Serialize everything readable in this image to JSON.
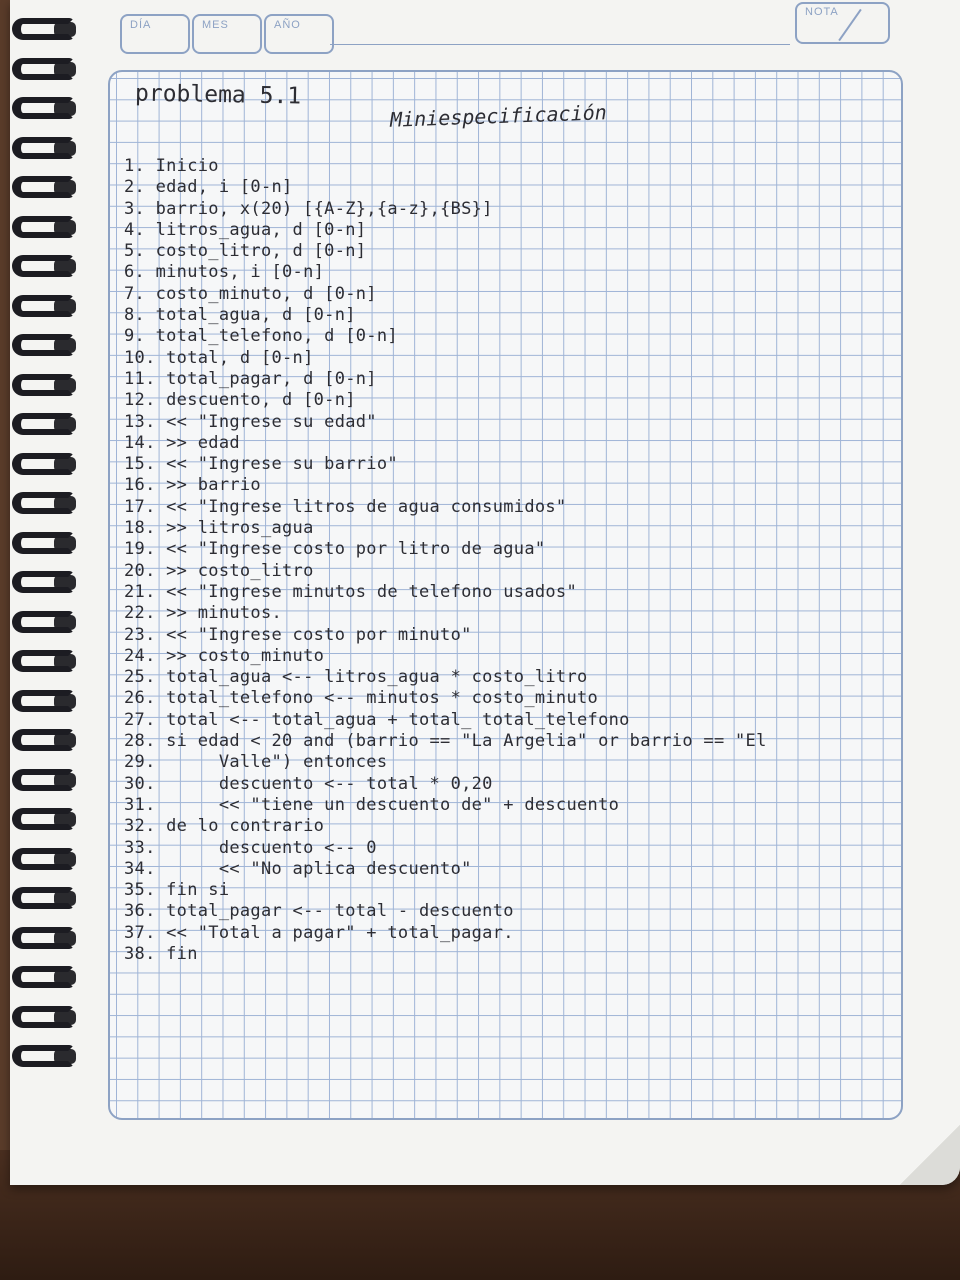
{
  "header": {
    "dia_label": "DÍA",
    "mes_label": "MES",
    "ano_label": "AÑO",
    "nota_label": "NOTA"
  },
  "heading": {
    "title": "problema 5.1",
    "subtitle": "Miniespecificación"
  },
  "lines": [
    "1. Inicio",
    "2. edad, i [0-n]",
    "3. barrio, x(20) [{A-Z},{a-z},{BS}]",
    "4. litros_agua, d [0-n]",
    "5. costo_litro, d [0-n]",
    "6. minutos, i [0-n]",
    "7. costo_minuto, d [0-n]",
    "8. total_agua, d [0-n]",
    "9. total_telefono, d [0-n]",
    "10. total, d [0-n]",
    "11. total_pagar, d [0-n]",
    "12. descuento, d [0-n]",
    "13. << \"Ingrese su edad\"",
    "14. >> edad",
    "15. << \"Ingrese su barrio\"",
    "16. >> barrio",
    "17. << \"Ingrese litros de agua consumidos\"",
    "18. >> litros_agua",
    "19. << \"Ingrese costo por litro de agua\"",
    "20. >> costo_litro",
    "21. << \"Ingrese minutos de telefono usados\"",
    "22. >> minutos.",
    "23. << \"Ingrese costo por minuto\"",
    "24. >> costo_minuto",
    "25. total_agua <-- litros_agua * costo_litro",
    "26. total_telefono <-- minutos * costo_minuto",
    "27. total <-- total_agua + total_ total_telefono",
    "28. si edad < 20 and (barrio == \"La Argelia\" or barrio == \"El",
    "29.      Valle\") entonces",
    "30.      descuento <-- total * 0,20",
    "31.      << \"tiene un descuento de\" + descuento",
    "32. de lo contrario",
    "33.      descuento <-- 0",
    "34.      << \"No aplica descuento\"",
    "35. fin si",
    "36. total_pagar <-- total - descuento",
    "37. << \"Total a pagar\" + total_pagar.",
    "38. fin"
  ]
}
